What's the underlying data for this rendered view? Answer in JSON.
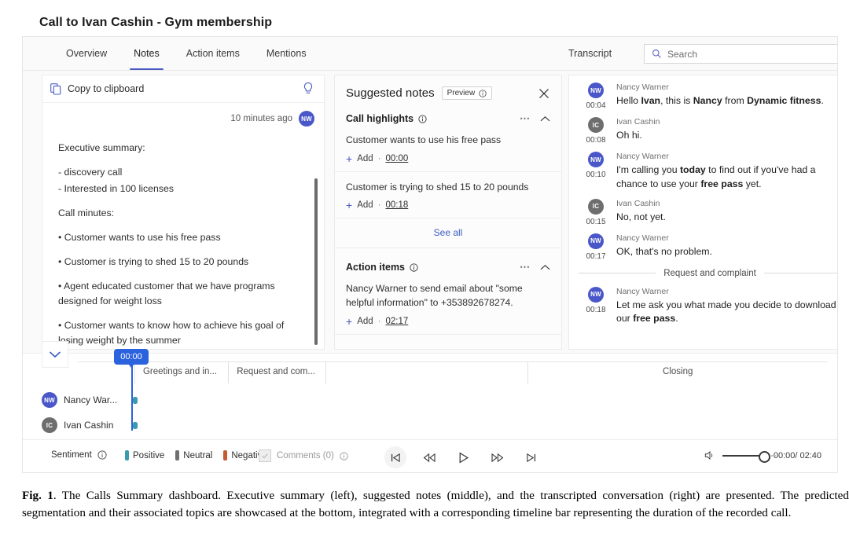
{
  "figure": {
    "title": "Call to Ivan Cashin - Gym membership",
    "caption_label": "Fig. 1",
    "caption_text": ". The Calls Summary dashboard. Executive summary (left), suggested notes (middle), and the transcripted conversation (right) are presented.  The predicted segmentation and their associated topics are showcased at the bottom, integrated with a corresponding timeline bar representing the duration of the recorded call."
  },
  "tabs": [
    {
      "label": "Overview",
      "active": false
    },
    {
      "label": "Notes",
      "active": true
    },
    {
      "label": "Action items",
      "active": false
    },
    {
      "label": "Mentions",
      "active": false
    }
  ],
  "transcript_header": {
    "label": "Transcript",
    "search_placeholder": "Search"
  },
  "notes": {
    "copy_label": "Copy to clipboard",
    "timestamp": "10 minutes ago",
    "author_initials": "NW",
    "paragraphs": [
      "Executive summary:",
      "- discovery call",
      "- Interested in 100 licenses",
      "Call minutes:",
      "• Customer wants to use his free pass",
      "• Customer is trying to shed 15 to 20 pounds",
      "• Agent educated customer that we have programs designed for weight loss",
      "• Customer wants to know how to achieve his goal of losing weight by the summer"
    ]
  },
  "suggested": {
    "title": "Suggested notes",
    "preview_label": "Preview",
    "sections": [
      {
        "title": "Call highlights",
        "items": [
          {
            "text": "Customer wants to use his free pass",
            "add_label": "Add",
            "time": "00:00"
          },
          {
            "text": "Customer is trying to shed 15 to 20 pounds",
            "add_label": "Add",
            "time": "00:18"
          }
        ],
        "see_all": "See all"
      },
      {
        "title": "Action items",
        "items": [
          {
            "text": "Nancy Warner to send email about \"some helpful information\" to +353892678274.",
            "add_label": "Add",
            "time": "02:17"
          }
        ]
      }
    ]
  },
  "transcript": {
    "entries": [
      {
        "initials": "NW",
        "speaker": "Nancy Warner",
        "time": "00:04",
        "parts": [
          {
            "t": "Hello "
          },
          {
            "t": "Ivan",
            "b": true
          },
          {
            "t": ", this is "
          },
          {
            "t": "Nancy",
            "b": true
          },
          {
            "t": " from "
          },
          {
            "t": "Dynamic fitness",
            "b": true
          },
          {
            "t": "."
          }
        ]
      },
      {
        "initials": "IC",
        "speaker": "Ivan Cashin",
        "time": "00:08",
        "parts": [
          {
            "t": "Oh hi."
          }
        ]
      },
      {
        "initials": "NW",
        "speaker": "Nancy Warner",
        "time": "00:10",
        "parts": [
          {
            "t": "I'm calling you "
          },
          {
            "t": "today",
            "b": true
          },
          {
            "t": " to find out if you've had a chance to use your "
          },
          {
            "t": "free pass",
            "b": true
          },
          {
            "t": " yet."
          }
        ]
      },
      {
        "initials": "IC",
        "speaker": "Ivan Cashin",
        "time": "00:15",
        "parts": [
          {
            "t": "No, not yet."
          }
        ]
      },
      {
        "initials": "NW",
        "speaker": "Nancy Warner",
        "time": "00:17",
        "parts": [
          {
            "t": "OK, that's no problem."
          }
        ]
      },
      {
        "divider": "Request and complaint"
      },
      {
        "initials": "NW",
        "speaker": "Nancy Warner",
        "time": "00:18",
        "parts": [
          {
            "t": "Let me ask you what made you decide to download our "
          },
          {
            "t": "free pass",
            "b": true
          },
          {
            "t": "."
          }
        ]
      }
    ]
  },
  "timeline": {
    "playhead_time": "00:00",
    "segments": [
      {
        "label": "Greetings and in...",
        "left_pct": 7.5,
        "right_pct": 20.0
      },
      {
        "label": "Request and com...",
        "left_pct": 20.0,
        "right_pct": 33.0
      },
      {
        "label": "Closing",
        "left_pct": 60.0,
        "right_pct": 100.0
      }
    ],
    "tracks": [
      {
        "initials": "NW",
        "name": "Nancy War...",
        "avatar": "nw"
      },
      {
        "initials": "IC",
        "name": "Ivan Cashin",
        "avatar": "ic"
      }
    ],
    "track_ticks": [
      [
        {
          "x": 2.0,
          "s": "neu"
        },
        {
          "x": 4.0,
          "s": "neu"
        },
        {
          "x": 9.5,
          "s": "pos"
        },
        {
          "x": 12.0,
          "s": "pos"
        },
        {
          "x": 16.0,
          "s": "pos"
        },
        {
          "x": 17.8,
          "s": "pos"
        },
        {
          "x": 19.6,
          "s": "pos"
        },
        {
          "x": 24.5,
          "s": "neu"
        },
        {
          "x": 26.3,
          "s": "neu"
        },
        {
          "x": 28.5,
          "s": "neu"
        },
        {
          "x": 33.0,
          "s": "neu"
        },
        {
          "x": 34.8,
          "s": "neu"
        },
        {
          "x": 36.8,
          "s": "pos"
        },
        {
          "x": 41.5,
          "s": "pos"
        },
        {
          "x": 43.3,
          "s": "pos"
        },
        {
          "x": 45.1,
          "s": "pos"
        },
        {
          "x": 49.5,
          "s": "neu"
        },
        {
          "x": 51.1,
          "s": "neu"
        },
        {
          "x": 52.7,
          "s": "neu"
        },
        {
          "x": 54.3,
          "s": "neu"
        },
        {
          "x": 55.9,
          "s": "neu"
        },
        {
          "x": 57.5,
          "s": "neu"
        },
        {
          "x": 59.1,
          "s": "neu"
        },
        {
          "x": 60.9,
          "s": "pos"
        },
        {
          "x": 62.7,
          "s": "pos"
        },
        {
          "x": 66.5,
          "s": "pos"
        },
        {
          "x": 68.6,
          "s": "pos"
        },
        {
          "x": 72.5,
          "s": "pos"
        },
        {
          "x": 74.3,
          "s": "pos"
        },
        {
          "x": 76.1,
          "s": "pos"
        },
        {
          "x": 78.0,
          "s": "pos"
        },
        {
          "x": 81.5,
          "s": "neu"
        },
        {
          "x": 83.1,
          "s": "neu"
        },
        {
          "x": 84.7,
          "s": "neu"
        },
        {
          "x": 86.3,
          "s": "neu"
        },
        {
          "x": 87.9,
          "s": "neu"
        },
        {
          "x": 89.5,
          "s": "neu"
        },
        {
          "x": 93.0,
          "s": "pos"
        },
        {
          "x": 94.8,
          "s": "pos"
        },
        {
          "x": 96.6,
          "s": "pos"
        },
        {
          "x": 98.4,
          "s": "pos"
        }
      ],
      [
        {
          "x": 6.5,
          "s": "neu"
        },
        {
          "x": 13.0,
          "s": "neu"
        },
        {
          "x": 20.5,
          "s": "pos"
        },
        {
          "x": 22.5,
          "s": "pos"
        },
        {
          "x": 28.0,
          "s": "neu"
        },
        {
          "x": 30.0,
          "s": "neu"
        },
        {
          "x": 37.5,
          "s": "neu"
        },
        {
          "x": 44.5,
          "s": "neu"
        },
        {
          "x": 50.5,
          "s": "pos"
        },
        {
          "x": 52.3,
          "s": "pos"
        },
        {
          "x": 54.1,
          "s": "pos"
        },
        {
          "x": 55.9,
          "s": "pos"
        },
        {
          "x": 57.7,
          "s": "pos"
        },
        {
          "x": 59.5,
          "s": "pos"
        },
        {
          "x": 62.0,
          "s": "pos"
        },
        {
          "x": 70.0,
          "s": "pos"
        },
        {
          "x": 75.0,
          "s": "neu"
        },
        {
          "x": 80.0,
          "s": "neu"
        },
        {
          "x": 86.0,
          "s": "pos"
        },
        {
          "x": 88.0,
          "s": "pos"
        },
        {
          "x": 93.0,
          "s": "pos"
        },
        {
          "x": 97.0,
          "s": "pos"
        }
      ]
    ]
  },
  "bottom": {
    "sentiment_label": "Sentiment",
    "legend": [
      {
        "label": "Positive",
        "color": "#3a9bb0"
      },
      {
        "label": "Neutral",
        "color": "#6e6e6e"
      },
      {
        "label": "Negative",
        "color": "#c55a33"
      }
    ],
    "comments_label": "Comments (0)",
    "current_time": "00:00",
    "total_time": "02:40",
    "time_display": "00:00/ 02:40"
  }
}
